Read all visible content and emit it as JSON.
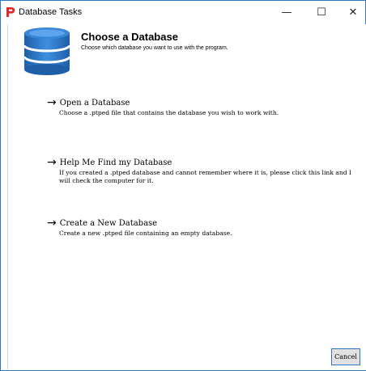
{
  "window": {
    "title": "Database Tasks",
    "buttons": {
      "minimize": "—",
      "maximize": "☐",
      "close": "✕"
    }
  },
  "header": {
    "title": "Choose a Database",
    "subtitle": "Choose which database you want to use with the program."
  },
  "options": [
    {
      "label": "Open a Database",
      "description": "Choose a .ptped file that contains the database you wish to work with."
    },
    {
      "label": "Help Me Find my Database",
      "description": "If you created a .ptped database and cannot remember where it is, please click this link and I will check the computer for it."
    },
    {
      "label": "Create a New Database",
      "description": "Create a new .ptped file containing an empty database."
    }
  ],
  "footer": {
    "cancel_label": "Cancel"
  },
  "icons": {
    "app": "p-logo-icon",
    "database": "database-icon",
    "arrow": "right-arrow-icon"
  },
  "colors": {
    "accent": "#2b78c9",
    "logo": "#e0282e",
    "db_blue": "#2a73c4"
  }
}
